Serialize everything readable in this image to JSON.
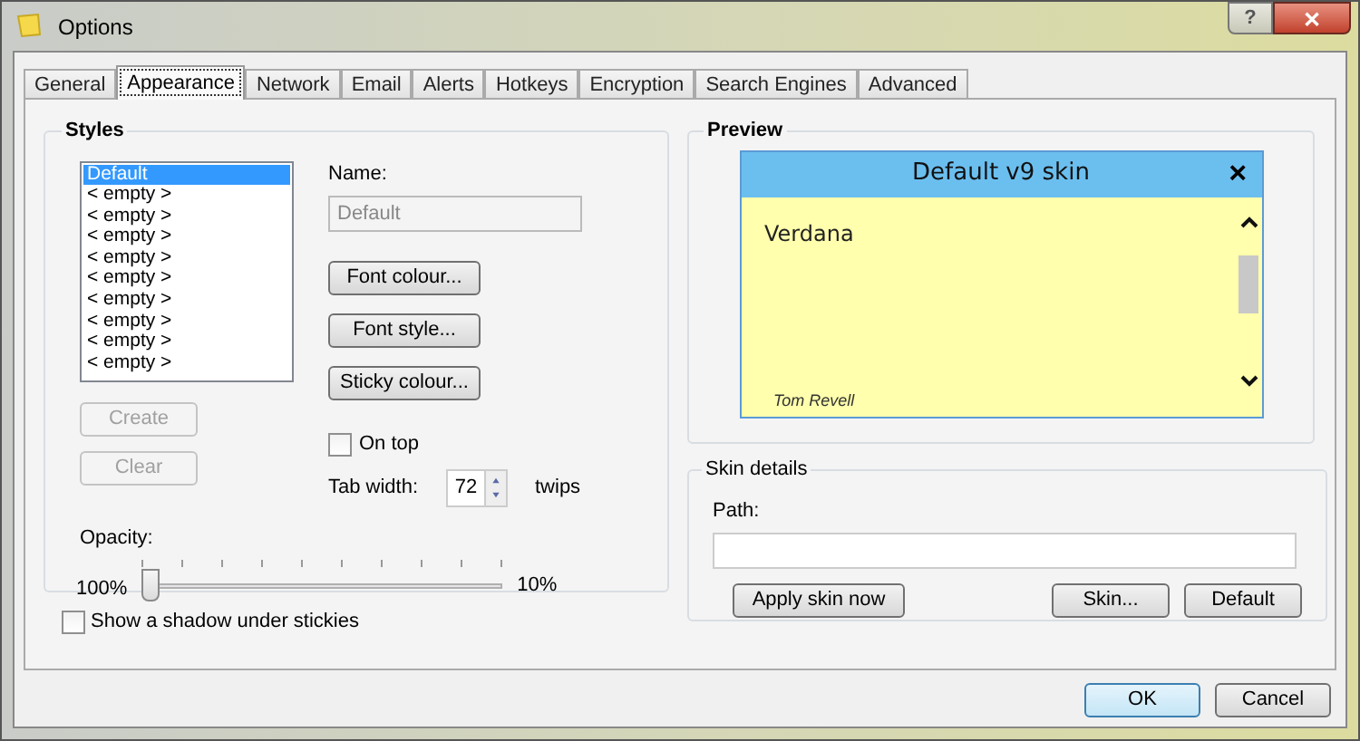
{
  "window": {
    "title": "Options",
    "help": "?",
    "close": "✕"
  },
  "tabs": [
    {
      "label": "General",
      "selected": false
    },
    {
      "label": "Appearance",
      "selected": true
    },
    {
      "label": "Network",
      "selected": false
    },
    {
      "label": "Email",
      "selected": false
    },
    {
      "label": "Alerts",
      "selected": false
    },
    {
      "label": "Hotkeys",
      "selected": false
    },
    {
      "label": "Encryption",
      "selected": false
    },
    {
      "label": "Search Engines",
      "selected": false
    },
    {
      "label": "Advanced",
      "selected": false
    }
  ],
  "styles": {
    "title": "Styles",
    "list": [
      {
        "label": "Default",
        "selected": true
      },
      {
        "label": "< empty >",
        "selected": false
      },
      {
        "label": "< empty >",
        "selected": false
      },
      {
        "label": "< empty >",
        "selected": false
      },
      {
        "label": "< empty >",
        "selected": false
      },
      {
        "label": "< empty >",
        "selected": false
      },
      {
        "label": "< empty >",
        "selected": false
      },
      {
        "label": "< empty >",
        "selected": false
      },
      {
        "label": "< empty >",
        "selected": false
      },
      {
        "label": "< empty >",
        "selected": false
      }
    ],
    "list_buttons": [
      {
        "label": "Create",
        "disabled": true
      },
      {
        "label": "Clear",
        "disabled": true
      }
    ],
    "name_label": "Name:",
    "name_value": "Default",
    "name_disabled": true,
    "buttons": [
      "Font colour...",
      "Font style...",
      "Sticky colour..."
    ],
    "on_top": {
      "label": "On top",
      "checked": false
    },
    "tab_width": {
      "label": "Tab width:",
      "value": "72",
      "unit": "twips"
    },
    "opacity": {
      "label": "Opacity:",
      "min_label": "100%",
      "max_label": "10%",
      "level": 0
    }
  },
  "shadow": {
    "label": "Show a shadow under stickies",
    "checked": false
  },
  "preview": {
    "title": "Preview",
    "sticky_title": "Default v9 skin",
    "close": "×",
    "text": "Verdana",
    "author": "Tom Revell"
  },
  "skin_details": {
    "title": "Skin details",
    "path_label": "Path:",
    "buttons": [
      "Apply skin now",
      "Skin...",
      "Default"
    ]
  },
  "dialog_buttons": [
    {
      "label": "OK",
      "default": true
    },
    {
      "label": "Cancel",
      "default": false
    }
  ]
}
